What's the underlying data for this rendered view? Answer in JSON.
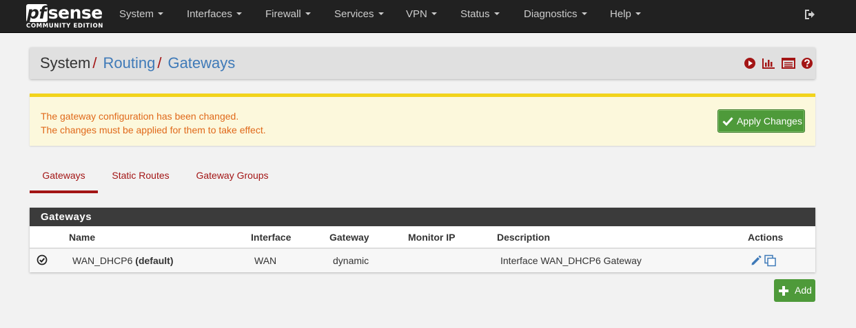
{
  "brand": {
    "name": "sense",
    "prefix": "pf",
    "edition": "COMMUNITY EDITION"
  },
  "nav": {
    "items": [
      {
        "label": "System"
      },
      {
        "label": "Interfaces"
      },
      {
        "label": "Firewall"
      },
      {
        "label": "Services"
      },
      {
        "label": "VPN"
      },
      {
        "label": "Status"
      },
      {
        "label": "Diagnostics"
      },
      {
        "label": "Help"
      }
    ],
    "logout_icon": "sign-out-icon"
  },
  "breadcrumb": {
    "root": "System",
    "sep": "/",
    "items": [
      "Routing",
      "Gateways"
    ],
    "icons": [
      "play-circle-icon",
      "bar-chart-icon",
      "log-list-icon",
      "help-question-icon"
    ]
  },
  "alert": {
    "line1": "The gateway configuration has been changed.",
    "line2": "The changes must be applied for them to take effect.",
    "apply_label": "Apply Changes"
  },
  "tabs": [
    {
      "label": "Gateways",
      "active": true
    },
    {
      "label": "Static Routes",
      "active": false
    },
    {
      "label": "Gateway Groups",
      "active": false
    }
  ],
  "table": {
    "title": "Gateways",
    "columns": [
      "Name",
      "Interface",
      "Gateway",
      "Monitor IP",
      "Description",
      "Actions"
    ],
    "rows": [
      {
        "status_icon": "check-circle-icon",
        "name": "WAN_DHCP6",
        "name_suffix": "(default)",
        "interface": "WAN",
        "gateway": "dynamic",
        "monitor_ip": "",
        "description": "Interface WAN_DHCP6 Gateway"
      }
    ]
  },
  "add_label": "Add",
  "colors": {
    "navbar": "#212121",
    "link": "#3f7ab8",
    "accent": "#a31515",
    "success": "#4e9a3a",
    "warning_bar": "#f2d31b",
    "warning_text": "#e0691a"
  }
}
